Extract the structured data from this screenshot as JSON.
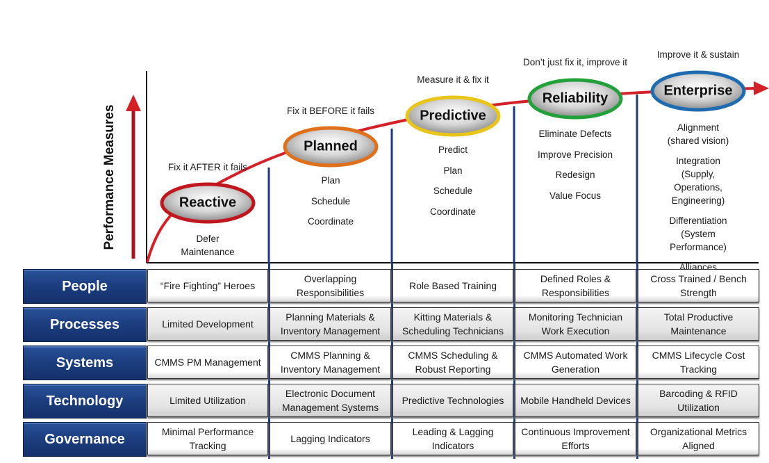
{
  "axis": {
    "y_label": "Performance Measures"
  },
  "colors": {
    "curve": "#d42027",
    "arrow": "#d42027",
    "divider": "#1e3a78",
    "row_header": "#1c3f80",
    "stage_borders": [
      "#c0161d",
      "#e0701a",
      "#e9c51a",
      "#22a03a",
      "#1e6bb0"
    ]
  },
  "stages": [
    {
      "name": "Reactive",
      "tagline": "Fix it AFTER it fails",
      "activities": [
        "Defer",
        "Maintenance"
      ]
    },
    {
      "name": "Planned",
      "tagline": "Fix it BEFORE it fails",
      "activities": [
        "Plan",
        "Schedule",
        "Coordinate"
      ]
    },
    {
      "name": "Predictive",
      "tagline": "Measure it & fix it",
      "activities": [
        "Predict",
        "Plan",
        "Schedule",
        "Coordinate"
      ]
    },
    {
      "name": "Reliability",
      "tagline": "Don’t just fix it, improve it",
      "activities": [
        "Eliminate Defects",
        "Improve Precision",
        "Redesign",
        "Value Focus"
      ]
    },
    {
      "name": "Enterprise",
      "tagline": "Improve it & sustain",
      "activities": [
        "Alignment",
        "(shared vision)",
        "Integration",
        "(Supply, Operations,",
        "Engineering)",
        "Differentiation",
        "(System Performance)",
        "Alliances"
      ]
    }
  ],
  "matrix": {
    "rows": [
      {
        "label": "People",
        "cells": [
          "“Fire Fighting” Heroes",
          "Overlapping Responsibilities",
          "Role Based Training",
          "Defined Roles & Responsibilities",
          "Cross Trained / Bench Strength"
        ]
      },
      {
        "label": "Processes",
        "cells": [
          "Limited Development",
          "Planning Materials & Inventory Management",
          "Kitting Materials & Scheduling Technicians",
          "Monitoring Technician Work Execution",
          "Total Productive Maintenance"
        ]
      },
      {
        "label": "Systems",
        "cells": [
          "CMMS PM Management",
          "CMMS Planning & Inventory Management",
          "CMMS Scheduling & Robust Reporting",
          "CMMS Automated Work Generation",
          "CMMS Lifecycle Cost Tracking"
        ]
      },
      {
        "label": "Technology",
        "cells": [
          "Limited Utilization",
          "Electronic Document Management Systems",
          "Predictive Technologies",
          "Mobile Handheld Devices",
          "Barcoding & RFID Utilization"
        ]
      },
      {
        "label": "Governance",
        "cells": [
          "Minimal Performance Tracking",
          "Lagging Indicators",
          "Leading & Lagging Indicators",
          "Continuous Improvement Efforts",
          "Organizational Metrics Aligned"
        ]
      }
    ]
  }
}
